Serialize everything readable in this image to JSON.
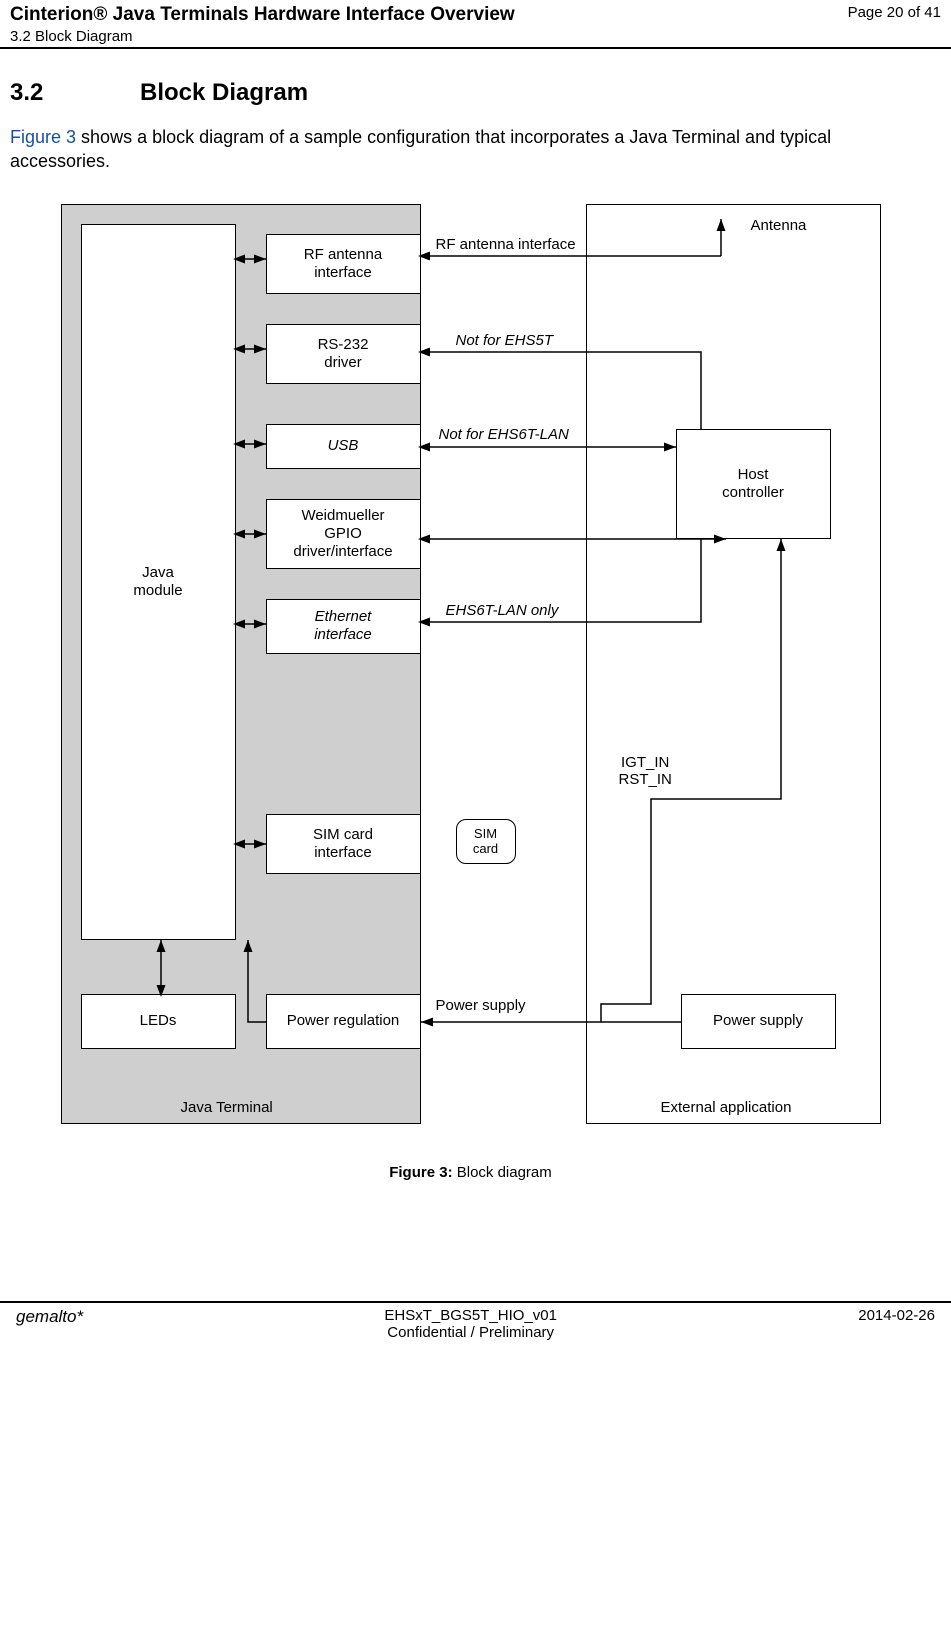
{
  "header": {
    "product": "Cinterion® Java Terminals Hardware Interface Overview",
    "section_ref": "3.2 Block Diagram",
    "page": "Page 20 of 41"
  },
  "section": {
    "number": "3.2",
    "title": "Block Diagram",
    "intro_prefix": "Figure 3",
    "intro_rest": " shows a block diagram of a sample configuration that incorporates a Java Terminal and typical accessories."
  },
  "diagram": {
    "java_terminal_label": "Java Terminal",
    "external_app_label": "External application",
    "java_module": "Java\nmodule",
    "rf_antenna_box": "RF antenna\ninterface",
    "rs232_box": "RS-232\ndriver",
    "usb_box": "USB",
    "gpio_box": "Weidmueller\nGPIO\ndriver/interface",
    "ethernet_box": "Ethernet\ninterface",
    "sim_iface_box": "SIM card\ninterface",
    "leds_box": "LEDs",
    "power_reg_box": "Power regulation",
    "sim_card": "SIM\ncard",
    "host_ctrl": "Host\ncontroller",
    "power_supply": "Power supply",
    "antenna_label": "Antenna",
    "rf_conn_label": "RF antenna interface",
    "rs232_note": "Not for EHS5T",
    "usb_note": "Not for EHS6T-LAN",
    "eth_note": "EHS6T-LAN only",
    "igt_label": "IGT_IN\nRST_IN",
    "pwr_conn_label": "Power supply"
  },
  "figure_caption": {
    "lead": "Figure 3:",
    "text": "  Block diagram"
  },
  "footer": {
    "logo": "gemalto*",
    "doc_id": "EHSxT_BGS5T_HIO_v01",
    "confidential": "Confidential / Preliminary",
    "date": "2014-02-26"
  }
}
